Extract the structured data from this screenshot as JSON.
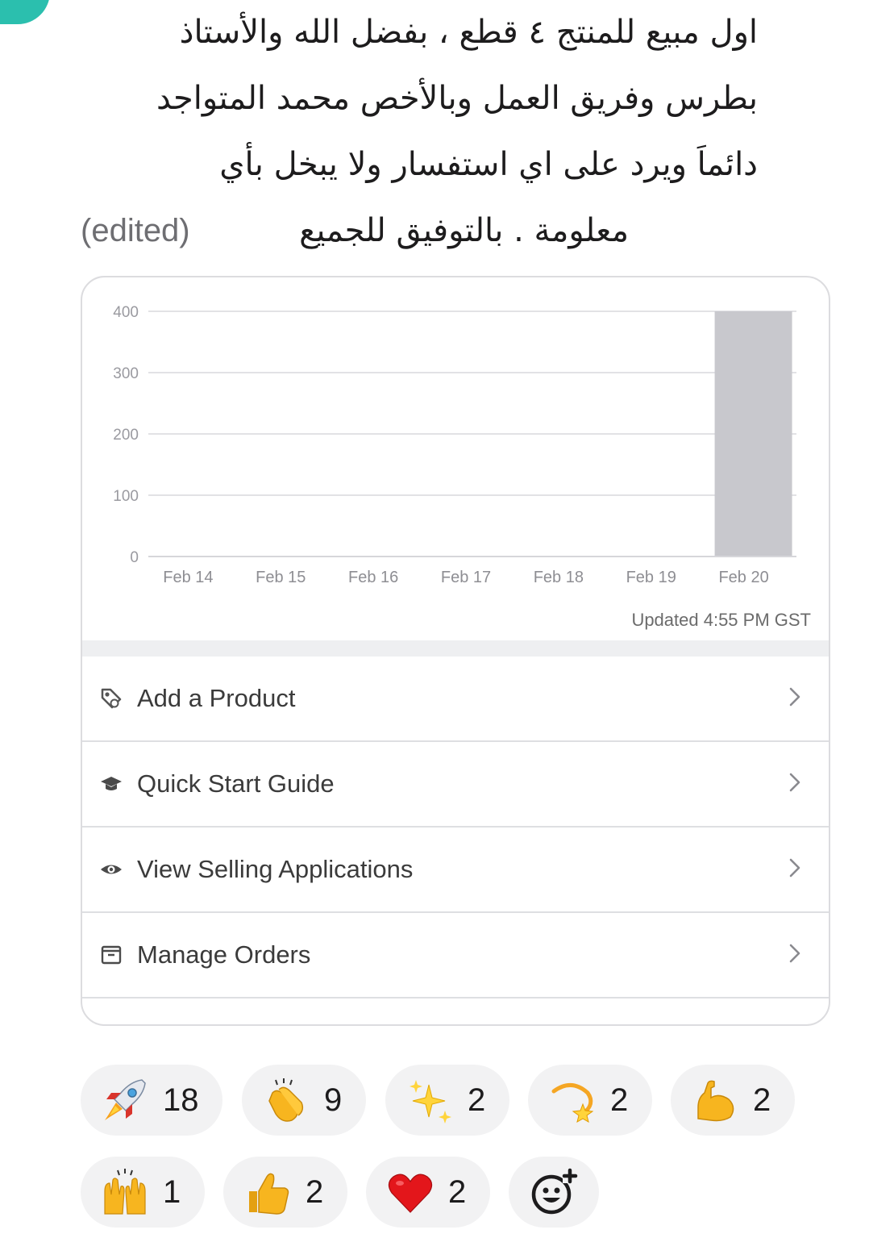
{
  "message": {
    "lines": [
      "اول مبيع للمنتج ٤ قطع ، بفضل الله والأستاذ",
      "بطرس وفريق العمل وبالأخص محمد المتواجد",
      "دائماَ ويرد على اي استفسار ولا يبخل بأي",
      "معلومة . بالتوفيق للجميع"
    ],
    "edited_label": "(edited)"
  },
  "card": {
    "updated_label": "Updated 4:55 PM GST",
    "menu": [
      {
        "label": "Add a Product",
        "icon": "tag-icon"
      },
      {
        "label": "Quick Start Guide",
        "icon": "graduation-cap-icon"
      },
      {
        "label": "View Selling Applications",
        "icon": "eye-icon"
      },
      {
        "label": "Manage Orders",
        "icon": "orders-box-icon"
      }
    ]
  },
  "chart_data": {
    "type": "bar",
    "categories": [
      "Feb 14",
      "Feb 15",
      "Feb 16",
      "Feb 17",
      "Feb 18",
      "Feb 19",
      "Feb 20"
    ],
    "values": [
      0,
      0,
      0,
      0,
      0,
      0,
      400
    ],
    "yticks": [
      0,
      100,
      200,
      300,
      400
    ],
    "ylim": [
      0,
      400
    ],
    "grid": true,
    "bar_color": "#c8c8cd",
    "title": "",
    "xlabel": "",
    "ylabel": ""
  },
  "reactions": {
    "row1": [
      {
        "emoji": "rocket-icon",
        "count": "18"
      },
      {
        "emoji": "clapping-hands-icon",
        "count": "9"
      },
      {
        "emoji": "sparkles-icon",
        "count": "2"
      },
      {
        "emoji": "dizzy-star-icon",
        "count": "2"
      },
      {
        "emoji": "flexed-biceps-icon",
        "count": "2"
      }
    ],
    "row2": [
      {
        "emoji": "raising-hands-icon",
        "count": "1"
      },
      {
        "emoji": "thumbs-up-icon",
        "count": "2"
      },
      {
        "emoji": "red-heart-icon",
        "count": "2"
      }
    ],
    "add_reaction": "add-reaction-icon"
  },
  "colors": {
    "accent_teal": "#2bbfae",
    "pill_bg": "#f2f2f3",
    "card_border": "#dcdcdf"
  }
}
